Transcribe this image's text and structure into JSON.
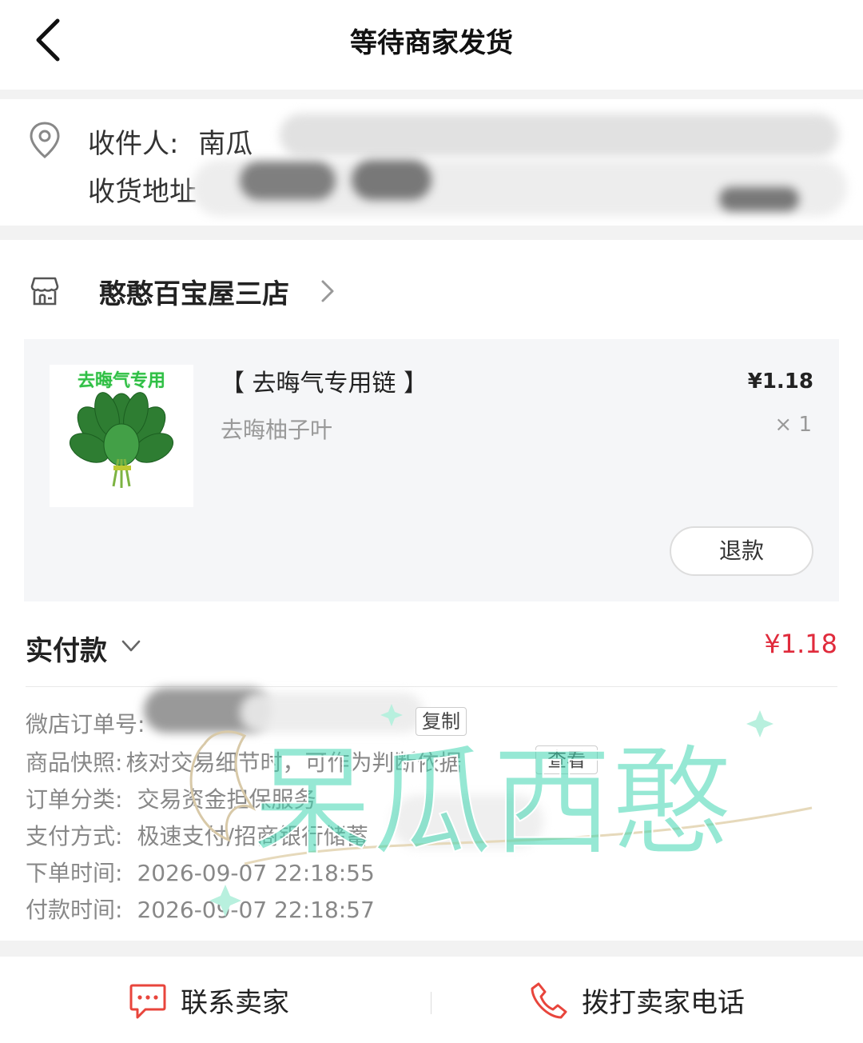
{
  "header": {
    "title": "等待商家发货"
  },
  "address": {
    "recipient_label": "收件人:",
    "recipient_name": "南瓜",
    "address_label": "收货地址"
  },
  "shop": {
    "name": "憨憨百宝屋三店"
  },
  "product": {
    "image_caption": "去晦气专用",
    "title": "【 去晦气专用链 】",
    "price": "¥1.18",
    "spec": "去晦柚子叶",
    "qty": "× 1",
    "refund_label": "退款"
  },
  "payment": {
    "paid_label": "实付款",
    "paid_amount": "¥1.18"
  },
  "order_info": {
    "order_no_label": "微店订单号:",
    "copy_label": "复制",
    "snapshot_label": "商品快照:",
    "snapshot_value": "核对交易细节时，可作为判断依据",
    "view_label": "查看",
    "category_label": "订单分类:",
    "category_value": "交易资金担保服务",
    "pay_method_label": "支付方式:",
    "pay_method_value": "极速支付/招商银行储蓄",
    "order_time_label": "下单时间:",
    "order_time_value": "2026-09-07 22:18:55",
    "pay_time_label": "付款时间:",
    "pay_time_value": "2026-09-07 22:18:57"
  },
  "watermark": {
    "text": "呆瓜西憨"
  },
  "footer": {
    "contact_label": "联系卖家",
    "call_label": "拨打卖家电话"
  },
  "colors": {
    "price_red": "#e02b3c",
    "icon_red": "#e8453c",
    "watermark_teal": "#3fd6b0"
  }
}
